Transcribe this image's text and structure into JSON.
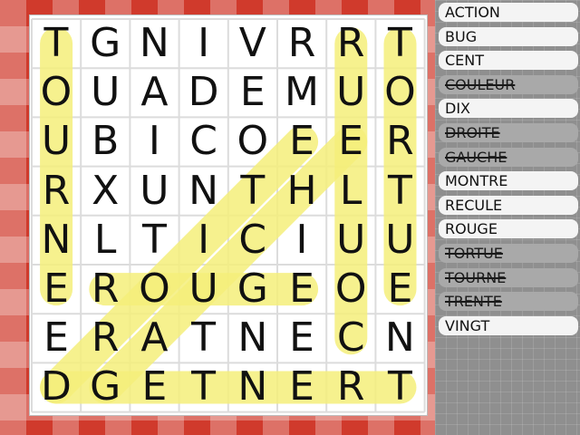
{
  "palette": {
    "highlight": "#f4ef7a",
    "letter": "#111111",
    "found_bg": "#a9a9a9",
    "open_bg": "#f4f4f4",
    "tablecloth_red": "#d03a2c"
  },
  "grid": {
    "rows": [
      "TGNIVRRT",
      "OUADEMUO",
      "UBICOEER",
      "RXUNTHLT",
      "NLTICIUU",
      "EROUGEOE",
      "ERATNECN",
      "DGETNERT"
    ]
  },
  "highlights": [
    {
      "word": "TOURNE",
      "from": [
        0,
        0
      ],
      "to": [
        5,
        0
      ]
    },
    {
      "word": "TORTUE",
      "from": [
        0,
        7
      ],
      "to": [
        5,
        7
      ]
    },
    {
      "word": "RUELUOC",
      "from": [
        0,
        6
      ],
      "to": [
        6,
        6
      ]
    },
    {
      "word": "TRENTE",
      "from": [
        7,
        7
      ],
      "to": [
        7,
        0
      ]
    },
    {
      "word": "ROUGE",
      "from": [
        5,
        1
      ],
      "to": [
        5,
        5
      ]
    },
    {
      "word": "DROITE",
      "from": [
        7,
        0
      ],
      "to": [
        2,
        5
      ]
    },
    {
      "word": "GAUCHE",
      "from": [
        7,
        1
      ],
      "to": [
        2,
        6
      ]
    }
  ],
  "words": [
    {
      "label": "ACTION",
      "found": false
    },
    {
      "label": "BUG",
      "found": false
    },
    {
      "label": "CENT",
      "found": false
    },
    {
      "label": "COULEUR",
      "found": true
    },
    {
      "label": "DIX",
      "found": false
    },
    {
      "label": "DROITE",
      "found": true
    },
    {
      "label": "GAUCHE",
      "found": true
    },
    {
      "label": "MONTRE",
      "found": false
    },
    {
      "label": "RECULE",
      "found": false
    },
    {
      "label": "ROUGE",
      "found": false
    },
    {
      "label": "TORTUE",
      "found": true
    },
    {
      "label": "TOURNE",
      "found": true
    },
    {
      "label": "TRENTE",
      "found": true
    },
    {
      "label": "VINGT",
      "found": false
    }
  ]
}
